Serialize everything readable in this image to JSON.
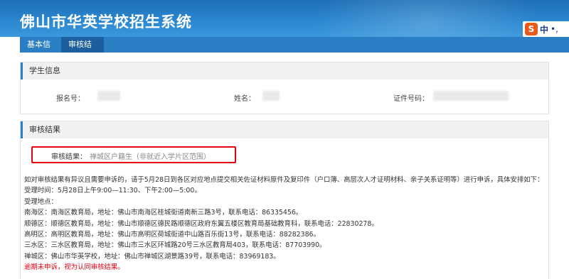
{
  "header": {
    "title": "佛山市华英学校招生系统"
  },
  "ime": {
    "logo": "S",
    "lang": "中",
    "dot": "•,"
  },
  "nav": {
    "tabs": [
      {
        "label": "基本信息"
      },
      {
        "label": "审核结果"
      }
    ]
  },
  "student_info": {
    "heading": "学生信息",
    "fields": [
      {
        "label": "报名号："
      },
      {
        "label": "姓名："
      },
      {
        "label": "证件号码："
      }
    ]
  },
  "review_result": {
    "heading": "审核结果",
    "label": "审核结果：",
    "value": "禅城区户籍生（非就近入学片区范围）"
  },
  "notice": {
    "lines": [
      "如对审核结果有异议且需要申诉的，请于5月28日到各区对应地点提交相关佐证材料原件及复印件（户口簿、高层次人才证明材料、亲子关系证明等）进行申诉，具体安排如下：",
      "受理时间：5月28日上午9:00—11:30、下午2:00—5:00。",
      "受理地点：",
      "南海区：南海区教育局，地址：佛山市南海区桂城街道南新三路3号，联系电话：86335456。",
      "顺德区：顺德区教育局，地址：佛山市顺德区德民路顺德区政府东翼五楼区教育局基础教育科，联系电话：22830278。",
      "高明区：高明区教育局，地址：佛山市高明区荷城街道中山路百乐街13号，联系电话：88282386。",
      "三水区：三水区教育局，地址：佛山市三水区环城路20号三水区教育局403，联系电话：87703990。",
      "禅城区：佛山市华英学校，地址：佛山市禅城区湖景路39号，联系电话：83969183。"
    ],
    "warning": "逾期未申诉，视为认同审核结果。"
  }
}
